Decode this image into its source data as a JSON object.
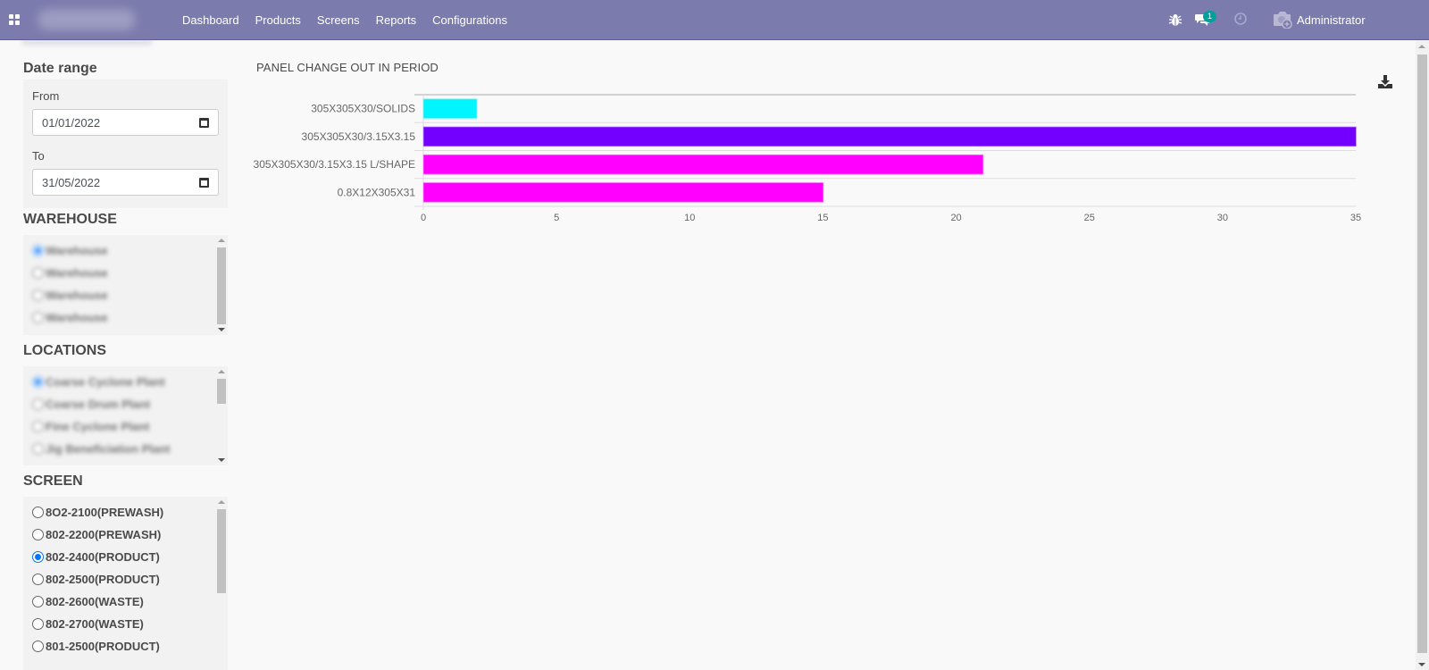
{
  "navbar": {
    "menu": [
      "Dashboard",
      "Products",
      "Screens",
      "Reports",
      "Configurations"
    ],
    "chat_badge": "1",
    "user_name": "Administrator",
    "bg_color": "#7c7bad"
  },
  "sidebar": {
    "date_range": {
      "title": "Date range",
      "from_label": "From",
      "from_value": "01/01/2022",
      "to_label": "To",
      "to_value": "31/05/2022"
    },
    "warehouse": {
      "title": "WAREHOUSE",
      "items": [
        {
          "label": "Warehouse",
          "checked": true
        },
        {
          "label": "Warehouse",
          "checked": false
        },
        {
          "label": "Warehouse",
          "checked": false
        },
        {
          "label": "Warehouse",
          "checked": false
        }
      ]
    },
    "locations": {
      "title": "LOCATIONS",
      "items": [
        {
          "label": "Coarse Cyclone Plant",
          "checked": true
        },
        {
          "label": "Coarse Drum Plant",
          "checked": false
        },
        {
          "label": "Fine Cyclone Plant",
          "checked": false
        },
        {
          "label": "Jig Beneficiation Plant",
          "checked": false
        }
      ]
    },
    "screen": {
      "title": "SCREEN",
      "items": [
        {
          "label": "8O2-2100(PREWASH)",
          "checked": false
        },
        {
          "label": "802-2200(PREWASH)",
          "checked": false
        },
        {
          "label": "802-2400(PRODUCT)",
          "checked": true
        },
        {
          "label": "802-2500(PRODUCT)",
          "checked": false
        },
        {
          "label": "802-2600(WASTE)",
          "checked": false
        },
        {
          "label": "802-2700(WASTE)",
          "checked": false
        },
        {
          "label": "801-2500(PRODUCT)",
          "checked": false
        }
      ]
    }
  },
  "chart_data": {
    "type": "bar",
    "orientation": "horizontal",
    "title": "PANEL CHANGE OUT IN PERIOD",
    "categories": [
      "305X305X30/SOLIDS",
      "305X305X30/3.15X3.15",
      "305X305X30/3.15X3.15 L/SHAPE",
      "0.8X12X305X31"
    ],
    "values": [
      2,
      35,
      21,
      15
    ],
    "colors": [
      "#00f5ff",
      "#7300ff",
      "#ff00ff",
      "#ff00ff"
    ],
    "xlabel": "",
    "ylabel": "",
    "xlim": [
      0,
      35
    ],
    "xticks": [
      0,
      5,
      10,
      15,
      20,
      25,
      30,
      35
    ],
    "grid": true,
    "legend": "none"
  },
  "icons": {
    "apps": "apps-grid-icon",
    "bug": "bug-icon",
    "chat": "chat-icon",
    "clock": "clock-icon",
    "avatar": "camera-avatar-icon",
    "download": "download-icon",
    "calendar": "calendar-icon"
  }
}
